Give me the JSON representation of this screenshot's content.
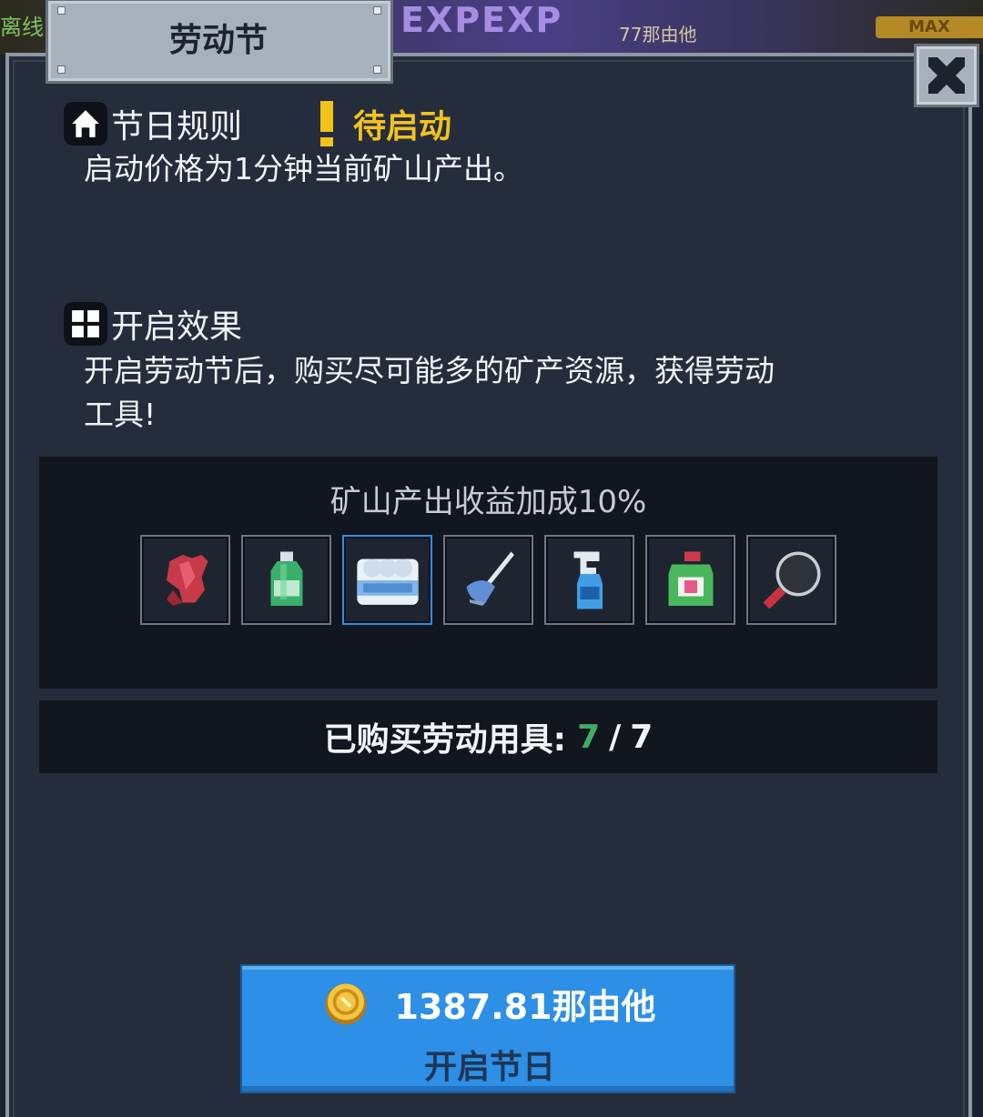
{
  "background": {
    "left_text": "离线",
    "mid_text": "EXPEXP",
    "mid_sub": "77那由他",
    "max_badge": "MAX"
  },
  "dialog": {
    "title": "劳动节",
    "close_icon": "close-x-icon"
  },
  "rules": {
    "icon": "home-icon",
    "title": "节日规则",
    "status": "待启动",
    "text": "启动价格为1分钟当前矿山产出。"
  },
  "effect": {
    "icon": "grid-icon",
    "title": "开启效果",
    "text_line1": "开启劳动节后，购买尽可能多的矿产资源，获得劳动",
    "text_line2": "工具!",
    "bonus": "矿山产出收益加成10%",
    "tools": [
      {
        "name": "rubber-gloves-icon"
      },
      {
        "name": "dish-soap-bottle-icon"
      },
      {
        "name": "toilet-paper-pack-icon",
        "selected": true
      },
      {
        "name": "scrub-brush-icon"
      },
      {
        "name": "spray-bottle-icon"
      },
      {
        "name": "detergent-jug-icon"
      },
      {
        "name": "frying-pan-icon"
      }
    ]
  },
  "purchased": {
    "label": "已购买劳动用具:",
    "have": "7",
    "sep": "/",
    "total": "7"
  },
  "start_button": {
    "coin_icon": "gold-coin-icon",
    "price": "1387.81那由他",
    "label": "开启节日"
  },
  "colors": {
    "panel_bg": "#252d3d",
    "status_yellow": "#f3c21c",
    "count_green": "#3fae62",
    "button_blue": "#2d8fe6"
  }
}
